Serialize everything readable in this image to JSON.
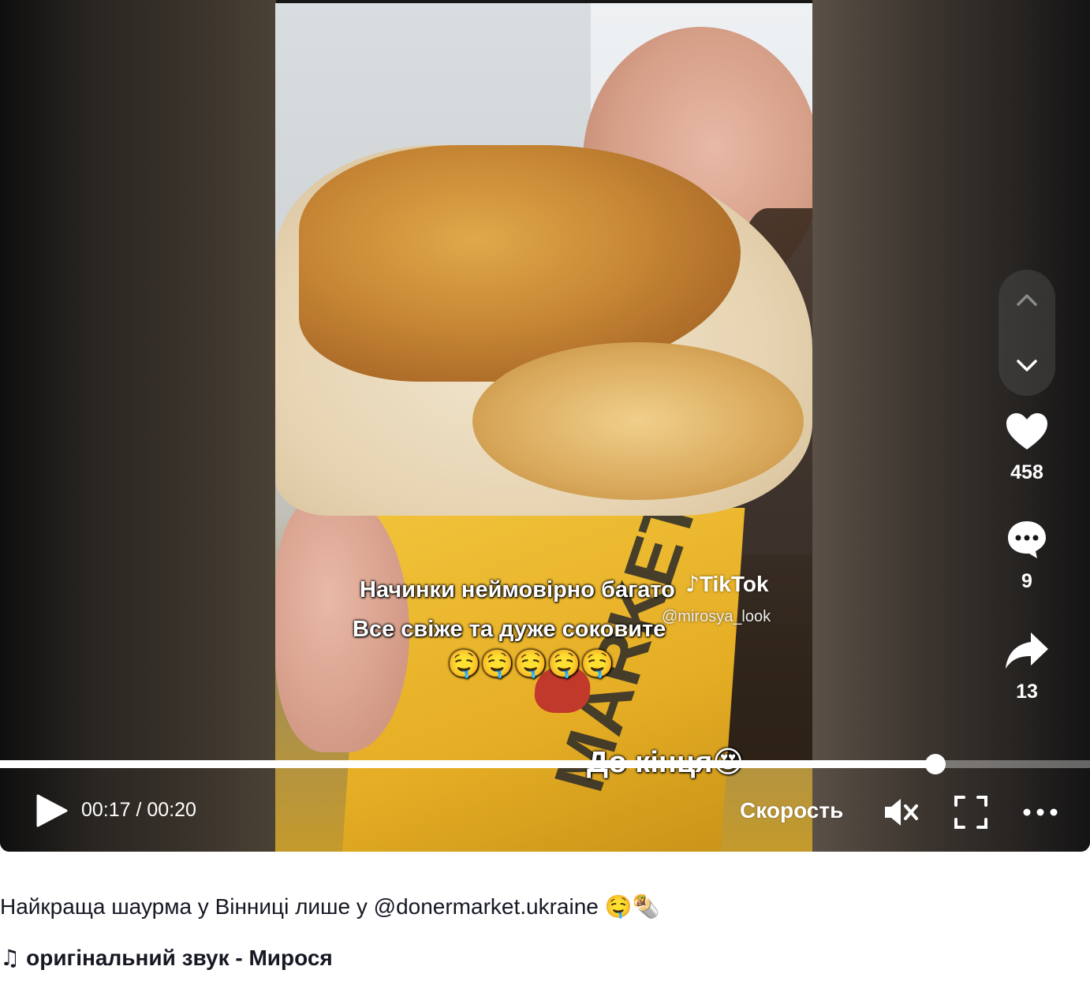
{
  "video": {
    "overlay_line1": "Начинки неймовірно багато",
    "overlay_line2": "Все свіже та дуже соковите",
    "overlay_emojis": "🤤🤤🤤🤤🤤",
    "overlay_bottom": "До кінця😍",
    "watermark": "TikTok",
    "watermark_user": "@mirosya_look",
    "bag_text": "MARKET"
  },
  "actions": {
    "likes": "458",
    "comments": "9",
    "shares": "13"
  },
  "controls": {
    "time": "00:17 / 00:20",
    "progress": 0.858,
    "speed_label": "Скорость"
  },
  "post": {
    "caption": "Найкраща шаурма у Вінниці лише у @donermarket.ukraine",
    "caption_emojis": "🤤🌯",
    "music": "оригінальний звук - Мирося"
  }
}
